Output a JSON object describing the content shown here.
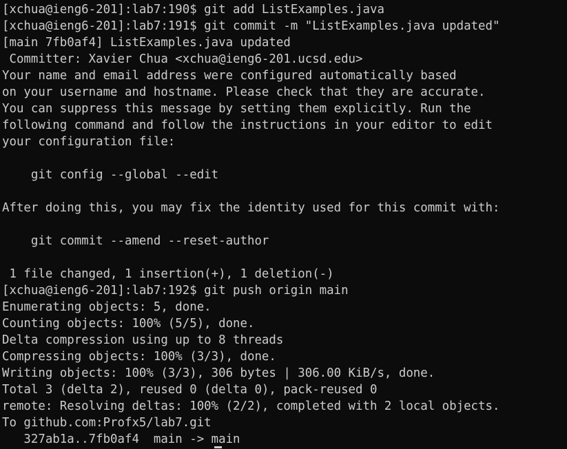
{
  "terminal": {
    "lines": [
      "[xchua@ieng6-201]:lab7:190$ git add ListExamples.java",
      "[xchua@ieng6-201]:lab7:191$ git commit -m \"ListExamples.java updated\"",
      "[main 7fb0af4] ListExamples.java updated",
      " Committer: Xavier Chua <xchua@ieng6-201.ucsd.edu>",
      "Your name and email address were configured automatically based",
      "on your username and hostname. Please check that they are accurate.",
      "You can suppress this message by setting them explicitly. Run the",
      "following command and follow the instructions in your editor to edit",
      "your configuration file:",
      "",
      "    git config --global --edit",
      "",
      "After doing this, you may fix the identity used for this commit with:",
      "",
      "    git commit --amend --reset-author",
      "",
      " 1 file changed, 1 insertion(+), 1 deletion(-)",
      "[xchua@ieng6-201]:lab7:192$ git push origin main",
      "Enumerating objects: 5, done.",
      "Counting objects: 100% (5/5), done.",
      "Delta compression using up to 8 threads",
      "Compressing objects: 100% (3/3), done.",
      "Writing objects: 100% (3/3), 306 bytes | 306.00 KiB/s, done.",
      "Total 3 (delta 2), reused 0 (delta 0), pack-reused 0",
      "remote: Resolving deltas: 100% (2/2), completed with 2 local objects.",
      "To github.com:Profx5/lab7.git",
      "   327ab1a..7fb0af4  main -> main"
    ]
  }
}
